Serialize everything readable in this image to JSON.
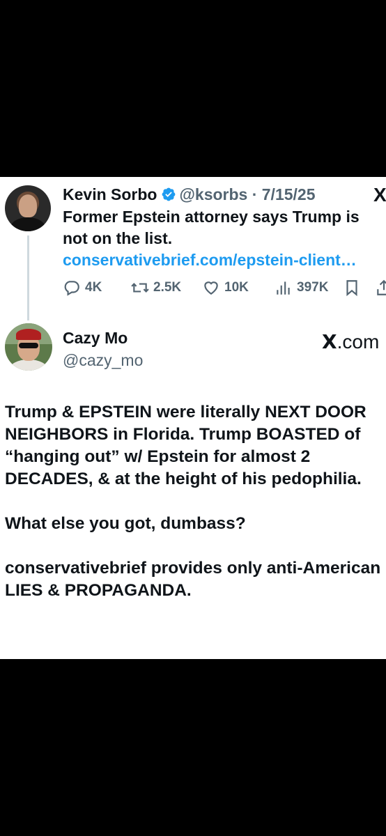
{
  "quoted_tweet": {
    "author_name": "Kevin Sorbo",
    "handle_date": "@ksorbs · 7/15/25",
    "text": "Former Epstein attorney says Trump is not on the list.",
    "link": "conservativebrief.com/epstein-client…",
    "replies": "4K",
    "reposts": "2.5K",
    "likes": "10K",
    "views": "397K",
    "platform_logo": "X"
  },
  "reply_tweet": {
    "author_name": "Cazy Mo",
    "handle": "@cazy_mo",
    "source": ".com",
    "paragraphs": [
      "Trump & EPSTEIN were literally NEXT DOOR NEIGHBORS in Florida. Trump BOASTED of “hanging out” w/ Epstein for almost 2 DECADES, & at the height of his pedophilia.",
      "What else you got, dumbass?",
      "conservativebrief provides only anti-American LIES & PROPAGANDA."
    ]
  },
  "icons": {
    "verified": "verified-badge-icon",
    "reply": "reply-icon",
    "repost": "repost-icon",
    "like": "heart-icon",
    "views": "views-icon",
    "bookmark": "bookmark-icon",
    "share": "share-icon"
  },
  "colors": {
    "link": "#1d9bf0",
    "secondary_text": "#536471",
    "verified": "#1d9bf0",
    "background": "#000000",
    "card": "#ffffff"
  }
}
